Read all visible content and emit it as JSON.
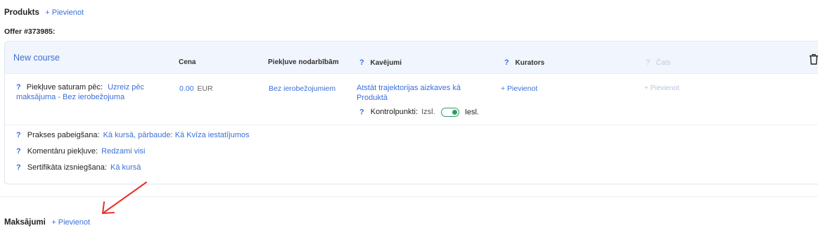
{
  "products": {
    "title": "Produkts",
    "add_label": "+ Pievienot"
  },
  "offer": {
    "title": "Offer #373985:"
  },
  "course": {
    "name": "New course",
    "headers": {
      "price": "Cena",
      "access": "Piekļuve nodarbībām",
      "delays_q": "?",
      "delays": "Kavējumi",
      "curators_q": "?",
      "curators": "Kurators",
      "chat_q": "?",
      "chat": "Čats"
    },
    "row": {
      "access_after_q": "?",
      "access_after_label": "Piekļuve saturam pēc:",
      "access_after_value": "Uzreiz pēc maksājuma",
      "access_after_sep": " - ",
      "access_after_value2": "Bez ierobežojuma",
      "price_value": "0.00",
      "price_currency": "EUR",
      "access_value": "Bez ierobežojumiem",
      "delays_value": "Atstāt trajektorijas aizkaves kā Produktā",
      "checkpoints_q": "?",
      "checkpoints_label": "Kontrolpunkti:",
      "checkpoints_off": "Izsl.",
      "checkpoints_on": "Iesl.",
      "checkpoints_enabled": true,
      "curators_add": "+ Pievienot",
      "chat_add": "+ Pievienot"
    },
    "settings": [
      {
        "q": "?",
        "label": "Prakses pabeigšana:",
        "value": "Kā kursā, pārbaude: Kā Kvīza iestatījumos"
      },
      {
        "q": "?",
        "label": "Komentāru piekļuve:",
        "value": "Redzami visi"
      },
      {
        "q": "?",
        "label": "Sertifikāta izsniegšana:",
        "value": "Kā kursā"
      }
    ]
  },
  "payments": {
    "title": "Maksājumi",
    "add_label": "+ Pievienot"
  },
  "colors": {
    "link": "#3b6fd8",
    "header_bg": "#f1f5fd",
    "toggle_on": "#2f9a62",
    "annotation_arrow": "#e8312a"
  }
}
